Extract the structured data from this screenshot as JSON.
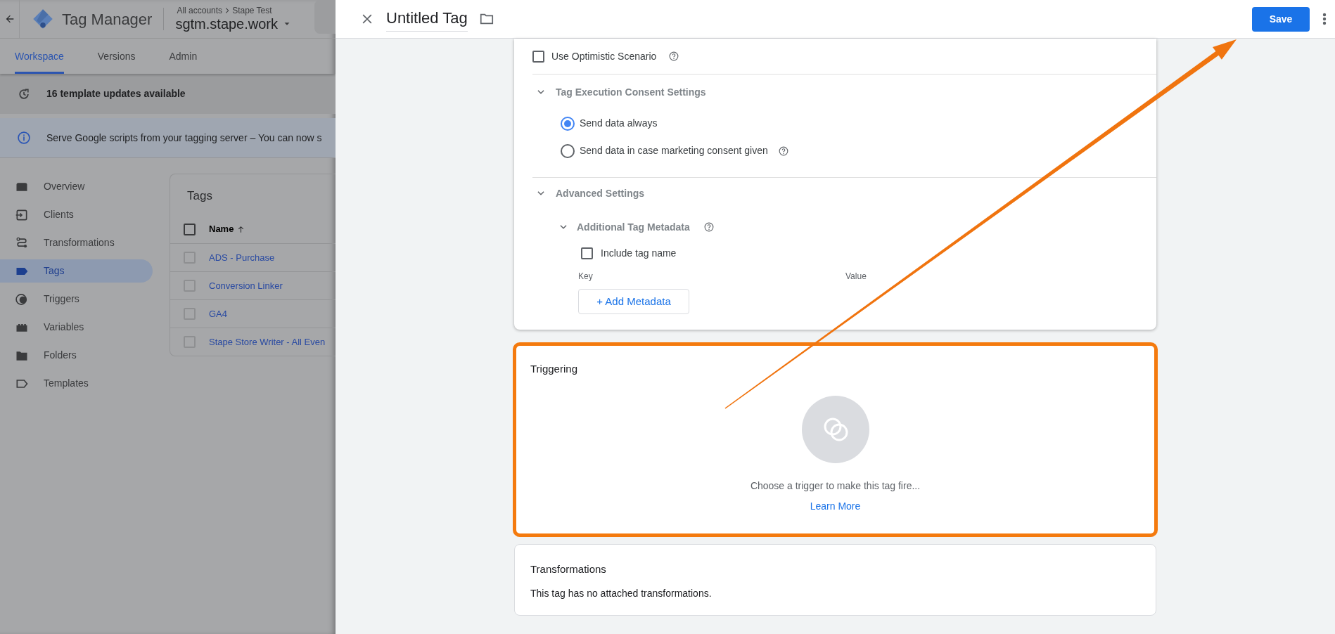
{
  "background_page": {
    "app_name": "Tag Manager",
    "breadcrumb": [
      "All accounts",
      "Stape Test"
    ],
    "container": "sgtm.stape.work",
    "tabs": [
      {
        "label": "Workspace",
        "selected": true
      },
      {
        "label": "Versions",
        "selected": false
      },
      {
        "label": "Admin",
        "selected": false
      }
    ],
    "notices": [
      {
        "kind": "update",
        "text": "16 template updates available"
      },
      {
        "kind": "info",
        "text": "Serve Google scripts from your tagging server – You can now s"
      }
    ],
    "sidebar": {
      "items": [
        {
          "label": "Overview",
          "selected": false
        },
        {
          "label": "Clients",
          "selected": false
        },
        {
          "label": "Transformations",
          "selected": false
        },
        {
          "label": "Tags",
          "selected": true
        },
        {
          "label": "Triggers",
          "selected": false
        },
        {
          "label": "Variables",
          "selected": false
        },
        {
          "label": "Folders",
          "selected": false
        },
        {
          "label": "Templates",
          "selected": false
        }
      ]
    },
    "tags_table": {
      "title": "Tags",
      "columns": [
        "Name"
      ],
      "select_all_checked": false,
      "rows": [
        {
          "name": "ADS - Purchase",
          "checked": false
        },
        {
          "name": "Conversion Linker",
          "checked": false
        },
        {
          "name": "GA4",
          "checked": false
        },
        {
          "name": "Stape Store Writer - All Even",
          "checked": false
        }
      ]
    }
  },
  "panel": {
    "title": "Untitled Tag",
    "save_button": "Save",
    "optimistic_scenario": {
      "label": "Use Optimistic Scenario",
      "checked": false
    },
    "consent": {
      "title": "Tag Execution Consent Settings",
      "expanded": true,
      "options": [
        {
          "label": "Send data always",
          "selected": true,
          "help": false
        },
        {
          "label": "Send data in case marketing consent given",
          "selected": false,
          "help": true
        }
      ]
    },
    "advanced": {
      "title": "Advanced Settings",
      "expanded": true,
      "metadata": {
        "title": "Additional Tag Metadata",
        "expanded": true,
        "include_tag_name": {
          "label": "Include tag name",
          "checked": false
        },
        "columns": [
          "Key",
          "Value"
        ],
        "add_button": "+ Add Metadata"
      }
    },
    "triggering": {
      "title": "Triggering",
      "message": "Choose a trigger to make this tag fire...",
      "link": "Learn More",
      "highlighted": true
    },
    "transformations": {
      "title": "Transformations",
      "message": "This tag has no attached transformations."
    }
  },
  "annotation": {
    "arrow_to_save": true
  }
}
